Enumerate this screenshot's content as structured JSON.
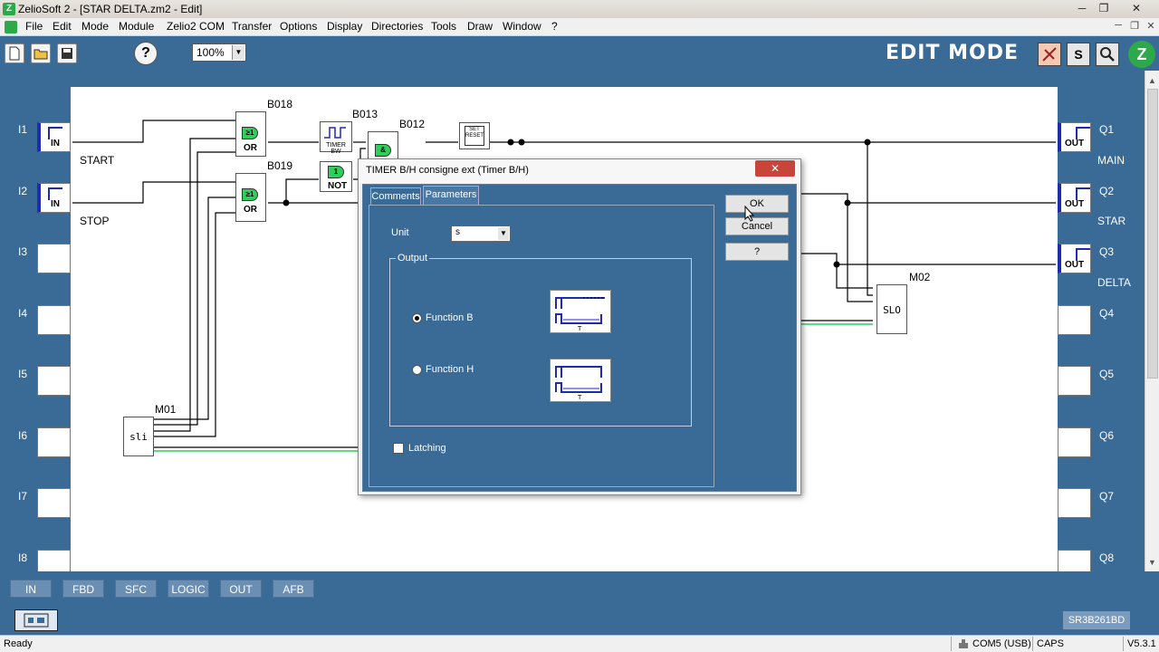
{
  "window": {
    "title": "ZelioSoft 2 - [STAR DELTA.zm2 - Edit]",
    "minimize": "─",
    "restore": "❐",
    "close": "✕"
  },
  "menu": {
    "items": [
      "File",
      "Edit",
      "Mode",
      "Module",
      "Zelio2 COM",
      "Transfer",
      "Options",
      "Display",
      "Directories",
      "Tools",
      "Draw",
      "Window",
      "?"
    ],
    "mdi_min": "─",
    "mdi_restore": "❐",
    "mdi_close": "✕"
  },
  "toolbar": {
    "help": "?",
    "zoom": "100%",
    "mode_title": "EDIT MODE",
    "sim_label": "S"
  },
  "inputs": {
    "labels": [
      "I1",
      "I2",
      "I3",
      "I4",
      "I5",
      "I6",
      "I7",
      "I8"
    ],
    "block_text": "IN",
    "names": [
      "START",
      "STOP"
    ]
  },
  "outputs": {
    "labels": [
      "Q1",
      "Q2",
      "Q3",
      "Q4",
      "Q5",
      "Q6",
      "Q7",
      "Q8"
    ],
    "block_text": "OUT",
    "names": [
      "MAIN",
      "STAR",
      "DELTA"
    ]
  },
  "blocks": {
    "b018": "B018",
    "b019": "B019",
    "b013": "B013",
    "b012": "B012",
    "m01": "M01",
    "m02": "M02",
    "or": "OR",
    "not": "NOT",
    "timer_bw": "TIMER BW",
    "set_reset": "SET RESET",
    "sli": "sli",
    "slo": "SLO",
    "and": "&"
  },
  "bottom_tabs": [
    "IN",
    "FBD",
    "SFC",
    "LOGIC",
    "OUT",
    "AFB"
  ],
  "module_model": "SR3B261BD",
  "status": {
    "ready": "Ready",
    "port": "COM5 (USB)",
    "caps": "CAPS",
    "version": "V5.3.1"
  },
  "dialog": {
    "title": "TIMER B/H consigne ext (Timer B/H)",
    "tab_comments": "Comments",
    "tab_parameters": "Parameters",
    "unit_label": "Unit",
    "unit_value": "s",
    "output_group": "Output",
    "function_b": "Function B",
    "function_h": "Function H",
    "function_b_selected": true,
    "latching": "Latching",
    "latching_checked": false,
    "ok": "OK",
    "cancel": "Cancel",
    "help": "?",
    "close": "✕",
    "tick_t": "T"
  }
}
